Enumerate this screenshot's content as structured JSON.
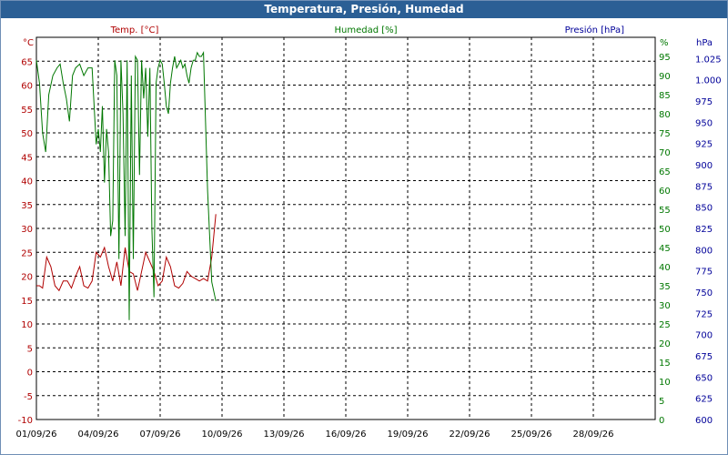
{
  "window": {
    "title": "Temperatura, Presión, Humedad"
  },
  "chart_data": {
    "type": "line",
    "title": "Temperatura, Presión, Humedad",
    "colors": {
      "temperature": "#b00000",
      "humidity": "#007700",
      "pressure": "#000099",
      "grid": "#000000"
    },
    "x_ticks": [
      "01/09/26",
      "04/09/26",
      "07/09/26",
      "10/09/26",
      "13/09/26",
      "16/09/26",
      "19/09/26",
      "22/09/26",
      "25/09/26",
      "28/09/26"
    ],
    "x_range": [
      0,
      30
    ],
    "axes": {
      "temperature": {
        "header": "Temp. [°C]",
        "unit": "°C",
        "range": [
          -10,
          70
        ],
        "ticks": [
          65,
          60,
          55,
          50,
          45,
          40,
          35,
          30,
          25,
          20,
          15,
          10,
          5,
          0,
          -5,
          -10
        ]
      },
      "humidity": {
        "header": "Humedad [%]",
        "unit": "%",
        "range": [
          0,
          100
        ],
        "ticks": [
          95,
          90,
          85,
          80,
          75,
          70,
          65,
          60,
          55,
          50,
          45,
          40,
          35,
          30,
          25,
          20,
          15,
          10,
          5,
          0
        ]
      },
      "pressure": {
        "header": "Presión [hPa]",
        "unit": "hPa",
        "range": [
          600,
          1050
        ],
        "ticks": [
          "1.025",
          "1.000",
          "975",
          "950",
          "925",
          "900",
          "875",
          "850",
          "825",
          "800",
          "775",
          "750",
          "725",
          "700",
          "675",
          "650",
          "625",
          "600"
        ]
      }
    },
    "grid": true,
    "series": [
      {
        "name": "Temp. [°C]",
        "axis": "temperature",
        "x": [
          0,
          0.15,
          0.3,
          0.5,
          0.7,
          0.9,
          1.1,
          1.3,
          1.5,
          1.7,
          1.9,
          2.1,
          2.3,
          2.5,
          2.7,
          2.9,
          3.1,
          3.3,
          3.5,
          3.7,
          3.9,
          4.1,
          4.3,
          4.5,
          4.7,
          4.9,
          5.1,
          5.3,
          5.5,
          5.7,
          5.9,
          6.1,
          6.3,
          6.5,
          6.7,
          6.9,
          7.1,
          7.3,
          7.5,
          7.7,
          7.9,
          8.1,
          8.3,
          8.5,
          8.7
        ],
        "values": [
          18,
          18,
          17.5,
          24,
          22,
          18,
          17,
          19,
          19,
          17.5,
          20,
          22,
          18,
          17.5,
          19,
          25,
          24,
          26,
          22,
          19,
          23,
          18,
          26,
          21,
          20.5,
          17,
          21,
          25,
          23,
          21,
          18,
          19,
          24,
          22,
          18,
          17.5,
          18.5,
          21,
          20,
          19.5,
          19,
          19.5,
          19,
          24,
          33
        ]
      },
      {
        "name": "Humedad [%]",
        "axis": "humidity",
        "x": [
          0,
          0.15,
          0.3,
          0.45,
          0.6,
          0.8,
          1,
          1.15,
          1.3,
          1.45,
          1.6,
          1.75,
          1.9,
          2.1,
          2.3,
          2.5,
          2.7,
          2.9,
          3,
          3.1,
          3.2,
          3.3,
          3.4,
          3.5,
          3.6,
          3.7,
          3.8,
          3.9,
          4,
          4.1,
          4.2,
          4.3,
          4.4,
          4.5,
          4.6,
          4.7,
          4.8,
          4.9,
          5,
          5.1,
          5.2,
          5.3,
          5.4,
          5.5,
          5.6,
          5.7,
          5.8,
          5.9,
          6,
          6.1,
          6.2,
          6.3,
          6.4,
          6.5,
          6.6,
          6.7,
          6.8,
          6.9,
          7,
          7.1,
          7.2,
          7.3,
          7.4,
          7.5,
          7.6,
          7.7,
          7.8,
          7.9,
          8,
          8.1,
          8.3,
          8.5,
          8.7
        ],
        "values": [
          94,
          88,
          75,
          70,
          85,
          90,
          92,
          93,
          88,
          84,
          78,
          90,
          92,
          93,
          90,
          92,
          92,
          72,
          76,
          70,
          82,
          62,
          76,
          70,
          48,
          52,
          94,
          90,
          42,
          94,
          80,
          48,
          94,
          26,
          90,
          42,
          95,
          94,
          64,
          94,
          84,
          92,
          74,
          92,
          50,
          32,
          88,
          92,
          94,
          93,
          88,
          82,
          80,
          88,
          92,
          95,
          92,
          93,
          94,
          92,
          93,
          90,
          88,
          92,
          94,
          94,
          96,
          95,
          95,
          96,
          60,
          36,
          31
        ]
      }
    ]
  }
}
